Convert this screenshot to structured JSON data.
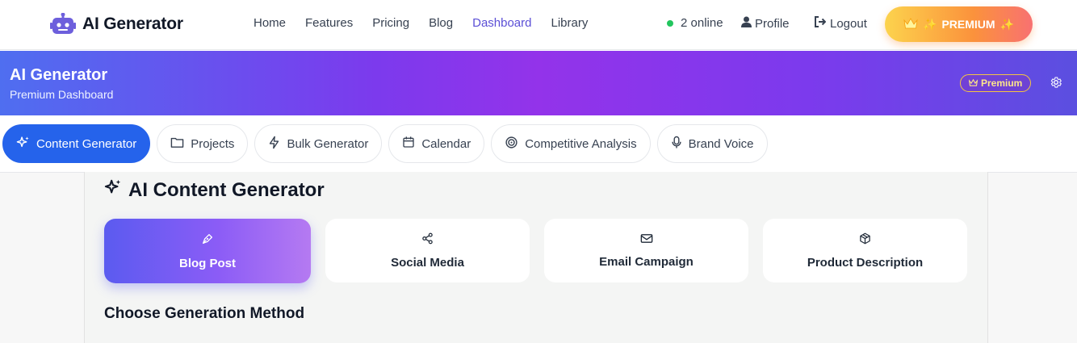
{
  "colors": {
    "accent": "#5b4fd6",
    "tab_active": "#2563eb",
    "online_dot": "#22c55e",
    "hero_gradient": [
      "#4f6ef0",
      "#9333ea",
      "#5b4fe0"
    ],
    "premium_gradient": [
      "#fcd34d",
      "#fb923c",
      "#f87171"
    ]
  },
  "nav": {
    "brand": "AI Generator",
    "brand_icon": "robot-icon",
    "links": [
      {
        "label": "Home",
        "active": false
      },
      {
        "label": "Features",
        "active": false
      },
      {
        "label": "Pricing",
        "active": false
      },
      {
        "label": "Blog",
        "active": false
      },
      {
        "label": "Dashboard",
        "active": true
      },
      {
        "label": "Library",
        "active": false
      }
    ],
    "online_text": "2 online",
    "profile_label": "Profile",
    "logout_label": "Logout",
    "premium_label": "PREMIUM"
  },
  "hero": {
    "title": "AI Generator",
    "subtitle": "Premium Dashboard",
    "badge": "Premium"
  },
  "tabs": [
    {
      "label": "Content Generator",
      "icon": "sparkles-icon",
      "active": true
    },
    {
      "label": "Projects",
      "icon": "folder-icon",
      "active": false
    },
    {
      "label": "Bulk Generator",
      "icon": "bolt-icon",
      "active": false
    },
    {
      "label": "Calendar",
      "icon": "calendar-icon",
      "active": false
    },
    {
      "label": "Competitive Analysis",
      "icon": "target-icon",
      "active": false
    },
    {
      "label": "Brand Voice",
      "icon": "microphone-icon",
      "active": false
    }
  ],
  "main": {
    "title": "AI Content Generator",
    "content_types": [
      {
        "label": "Blog Post",
        "icon": "pen-nib-icon",
        "active": true
      },
      {
        "label": "Social Media",
        "icon": "share-icon",
        "active": false
      },
      {
        "label": "Email Campaign",
        "icon": "envelope-icon",
        "active": false
      },
      {
        "label": "Product Description",
        "icon": "box-icon",
        "active": false
      }
    ],
    "method_title": "Choose Generation Method"
  }
}
